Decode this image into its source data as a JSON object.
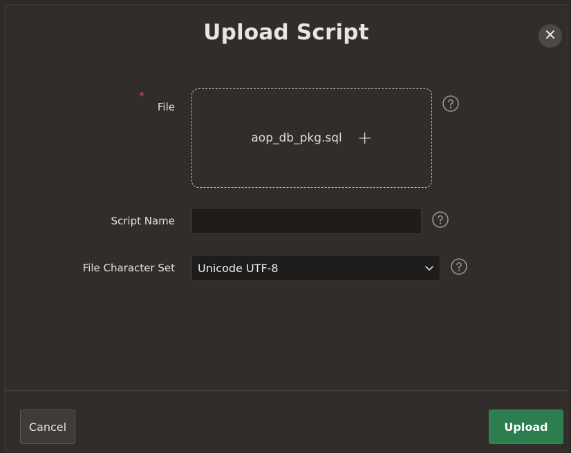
{
  "dialog": {
    "title": "Upload Script"
  },
  "form": {
    "file": {
      "label": "File",
      "required_marker": "*",
      "file_name": "aop_db_pkg.sql",
      "add_glyph": "+"
    },
    "script_name": {
      "label": "Script Name",
      "value": ""
    },
    "charset": {
      "label": "File Character Set",
      "selected": "Unicode UTF-8"
    }
  },
  "footer": {
    "cancel_label": "Cancel",
    "upload_label": "Upload"
  },
  "colors": {
    "background": "#2d2a27",
    "primary_button": "#2e7d4f",
    "required": "#e24a4a"
  }
}
